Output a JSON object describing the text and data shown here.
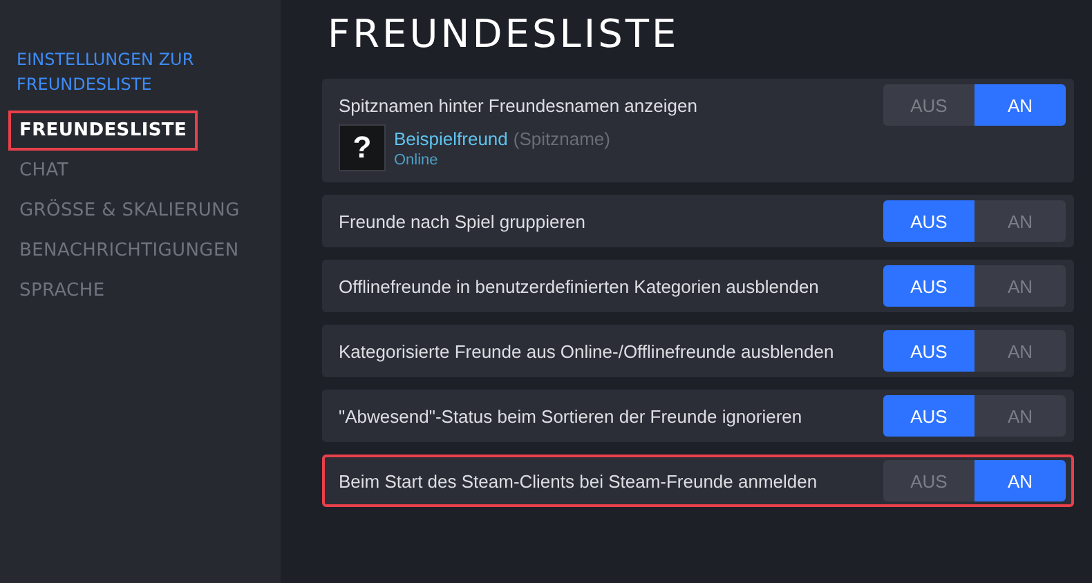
{
  "sidebar": {
    "heading": "EINSTELLUNGEN ZUR FREUNDESLISTE",
    "items": [
      {
        "label": "FREUNDESLISTE",
        "selected": true,
        "highlighted": true
      },
      {
        "label": "CHAT",
        "selected": false,
        "highlighted": false
      },
      {
        "label": "GRÖSSE & SKALIERUNG",
        "selected": false,
        "highlighted": false
      },
      {
        "label": "BENACHRICHTIGUNGEN",
        "selected": false,
        "highlighted": false
      },
      {
        "label": "SPRACHE",
        "selected": false,
        "highlighted": false
      }
    ]
  },
  "title": "FREUNDESLISTE",
  "settings": [
    {
      "label": "Spitznamen hinter Freundesnamen anzeigen",
      "off_label": "AUS",
      "on_label": "AN",
      "on": true,
      "highlighted": false,
      "preview": {
        "avatar": "?",
        "name": "Beispielfreund",
        "nickname": "(Spitzname)",
        "status": "Online"
      }
    },
    {
      "label": "Freunde nach Spiel gruppieren",
      "off_label": "AUS",
      "on_label": "AN",
      "on": false,
      "highlighted": false
    },
    {
      "label": "Offlinefreunde in benutzerdefinierten Kategorien ausblenden",
      "off_label": "AUS",
      "on_label": "AN",
      "on": false,
      "highlighted": false
    },
    {
      "label": "Kategorisierte Freunde aus Online-/Offlinefreunde ausblenden",
      "off_label": "AUS",
      "on_label": "AN",
      "on": false,
      "highlighted": false
    },
    {
      "label": "\"Abwesend\"-Status beim Sortieren der Freunde ignorieren",
      "off_label": "AUS",
      "on_label": "AN",
      "on": false,
      "highlighted": false
    },
    {
      "label": "Beim Start des Steam-Clients bei Steam-Freunde anmelden",
      "off_label": "AUS",
      "on_label": "AN",
      "on": true,
      "highlighted": true
    }
  ]
}
